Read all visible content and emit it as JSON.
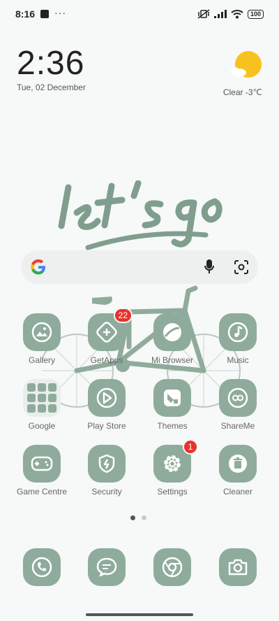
{
  "status_bar": {
    "time": "8:16",
    "battery": "100"
  },
  "clock": {
    "time": "2:36",
    "date": "Tue, 02 December"
  },
  "weather": {
    "description": "Clear  -3℃"
  },
  "wallpaper": {
    "slogan": "let's go"
  },
  "search": {
    "provider_icon": "google-icon"
  },
  "apps": [
    {
      "label": "Gallery",
      "icon": "gallery-icon"
    },
    {
      "label": "GetApps",
      "icon": "getapps-icon",
      "badge": "22"
    },
    {
      "label": "Mi Browser",
      "icon": "browser-icon"
    },
    {
      "label": "Music",
      "icon": "music-icon"
    },
    {
      "label": "Google",
      "icon": "folder-icon"
    },
    {
      "label": "Play Store",
      "icon": "play-store-icon"
    },
    {
      "label": "Themes",
      "icon": "themes-icon"
    },
    {
      "label": "ShareMe",
      "icon": "shareme-icon"
    },
    {
      "label": "Game Centre",
      "icon": "gamepad-icon"
    },
    {
      "label": "Security",
      "icon": "shield-icon"
    },
    {
      "label": "Settings",
      "icon": "gear-icon",
      "badge": "1"
    },
    {
      "label": "Cleaner",
      "icon": "trash-icon"
    }
  ],
  "dock": [
    {
      "icon": "phone-icon"
    },
    {
      "icon": "messages-icon"
    },
    {
      "icon": "chrome-icon"
    },
    {
      "icon": "camera-icon"
    }
  ],
  "colors": {
    "icon_bg": "#8fab9c",
    "badge": "#e4352c",
    "sun": "#f7c21d"
  }
}
